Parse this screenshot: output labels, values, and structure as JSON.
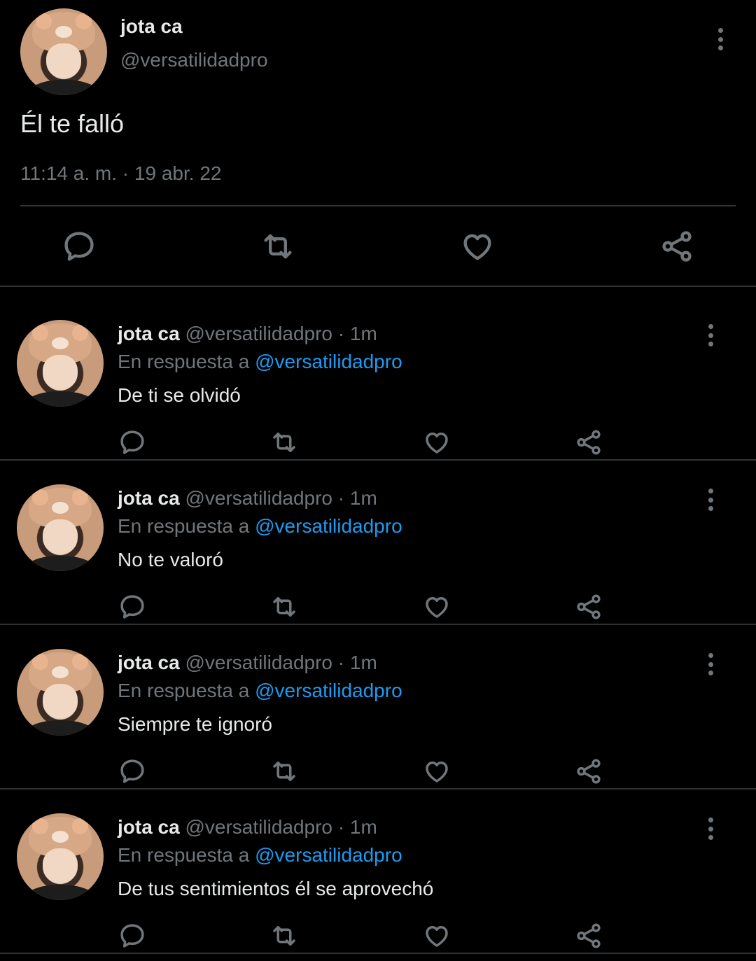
{
  "main_tweet": {
    "name": "jota ca",
    "handle": "@versatilidadpro",
    "text": "Él te falló",
    "time": "11:14 a. m.",
    "separator": "·",
    "date": "19 abr. 22",
    "actions": [
      "reply-icon",
      "retweet-icon",
      "like-icon",
      "share-icon"
    ]
  },
  "replies": [
    {
      "name": "jota ca",
      "handle": "@versatilidadpro",
      "dot": "·",
      "time": "1m",
      "reply_prefix": "En respuesta a",
      "mention": "@versatilidadpro",
      "text": "De ti se olvidó"
    },
    {
      "name": "jota ca",
      "handle": "@versatilidadpro",
      "dot": "·",
      "time": "1m",
      "reply_prefix": "En respuesta a",
      "mention": "@versatilidadpro",
      "text": "No te valoró"
    },
    {
      "name": "jota ca",
      "handle": "@versatilidadpro",
      "dot": "·",
      "time": "1m",
      "reply_prefix": "En respuesta a",
      "mention": "@versatilidadpro",
      "text": "Siempre te ignoró"
    },
    {
      "name": "jota ca",
      "handle": "@versatilidadpro",
      "dot": "·",
      "time": "1m",
      "reply_prefix": "En respuesta a",
      "mention": "@versatilidadpro",
      "text": "De tus sentimientos él se aprovechó"
    }
  ],
  "colors": {
    "background": "#000000",
    "text": "#e7e9ea",
    "secondary": "#71767b",
    "link": "#1d9bf0",
    "divider": "#2f3336"
  }
}
